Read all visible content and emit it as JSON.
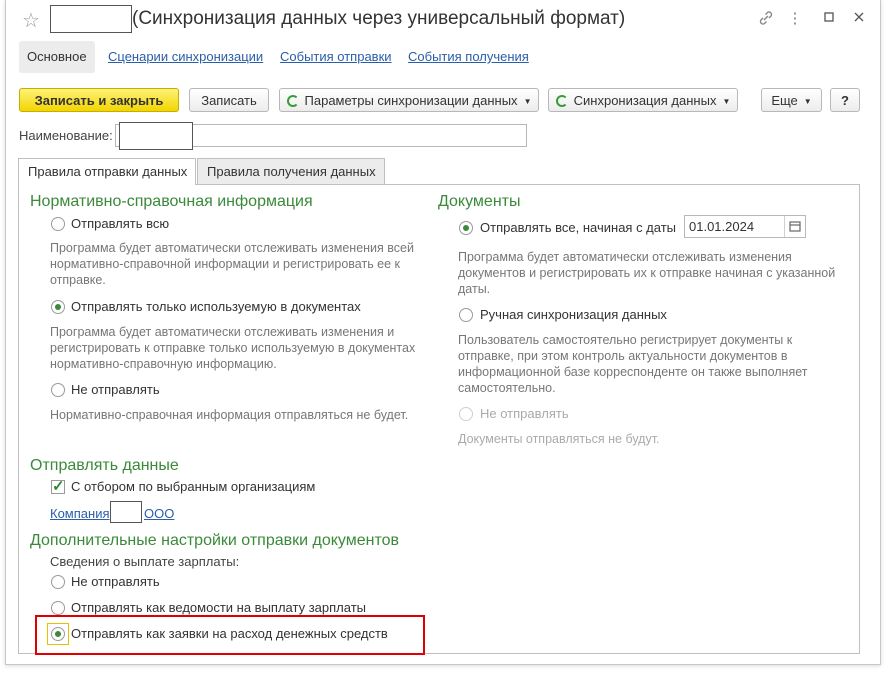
{
  "window": {
    "title": "(Синхронизация данных через универсальный формат)",
    "icons": [
      "star-icon",
      "link-icon",
      "more-icon",
      "maximize-icon",
      "close-icon"
    ]
  },
  "nav": {
    "tabs": [
      {
        "label": "Основное"
      },
      {
        "label": "Сценарии синхронизации"
      },
      {
        "label": "События отправки"
      },
      {
        "label": "События получения"
      }
    ]
  },
  "toolbar": {
    "save_close": "Записать и закрыть",
    "save": "Записать",
    "sync_params": "Параметры синхронизации данных",
    "sync_data": "Синхронизация данных",
    "more": "Еще",
    "help": "?"
  },
  "name_field": {
    "label": "Наименование:",
    "value": ""
  },
  "inner_tabs": [
    {
      "label": "Правила отправки данных"
    },
    {
      "label": "Правила получения данных"
    }
  ],
  "reference": {
    "title": "Нормативно-справочная информация",
    "option1": "Отправлять всю",
    "desc1": "Программа будет автоматически отслеживать изменения всей нормативно-справочной информации и регистрировать ее к отправке.",
    "option2": "Отправлять только используемую в документах",
    "desc2": "Программа будет автоматически отслеживать изменения и регистрировать к отправке только используемую в документах нормативно-справочную информацию.",
    "option3": "Не отправлять",
    "desc3": "Нормативно-справочная информация отправляться не будет.",
    "selected": 2
  },
  "documents": {
    "title": "Документы",
    "option1": "Отправлять все, начиная с даты",
    "date": "01.01.2024",
    "desc1": "Программа будет автоматически отслеживать изменения документов и регистрировать их к отправке начиная с указанной даты.",
    "option2": "Ручная синхронизация данных",
    "desc2": "Пользователь самостоятельно регистрирует документы к отправке, при этом контроль актуальности документов в информационной базе корреспонденте он также выполняет самостоятельно.",
    "option3": "Не отправлять",
    "desc3": "Документы отправляться не будут.",
    "selected": 1
  },
  "send_data": {
    "title": "Отправлять данные",
    "filter_label": "С отбором по выбранным организациям",
    "filter_checked": true,
    "company_prefix": "Компания",
    "company_suffix": "ООО"
  },
  "extra": {
    "title": "Дополнительные настройки отправки документов",
    "salary_label": "Сведения о выплате зарплаты:",
    "option1": "Не отправлять",
    "option2": "Отправлять как ведомости на выплату зарплаты",
    "option3": "Отправлять как заявки на расход денежных средств",
    "selected": 3
  },
  "colors": {
    "accent_green": "#3a8a3a",
    "link_blue": "#2a5ea8",
    "primary_yellow": "#f2d500",
    "highlight_red": "#e00000"
  }
}
